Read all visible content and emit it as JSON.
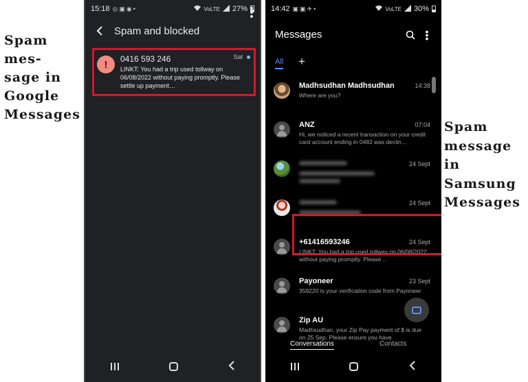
{
  "captions": {
    "google": "Spam mes-\nsage in\nGoogle\nMessages",
    "samsung": "Spam\nmessage\nin\nSamsung\nMessages"
  },
  "google": {
    "status": {
      "time": "15:18",
      "battery": "27%",
      "signal": "VoLTE"
    },
    "title": "Spam and blocked",
    "message": {
      "sender": "0416 593 246",
      "date": "Sat",
      "body": "LINKT: You had a trip used tollway on 06/08/2022 without paying promptly.  Please settle up payment…"
    }
  },
  "samsung": {
    "status": {
      "time": "14:42",
      "battery": "30%",
      "signal": "VoLTE"
    },
    "title": "Messages",
    "tabs": {
      "all": "All",
      "add": "+"
    },
    "conversations": [
      {
        "name": "Madhsudhan Madhsudhan",
        "date": "14:38",
        "preview": "Where are you?"
      },
      {
        "name": "ANZ",
        "date": "07:04",
        "preview": "Hi, we noticed a recent transaction on your credit card account ending in 0482 was declin…"
      },
      {
        "name": "",
        "date": "24 Sept",
        "preview": ""
      },
      {
        "name": "",
        "date": "24 Sept",
        "preview": ""
      },
      {
        "name": "+61416593246",
        "date": "24 Sept",
        "preview": "LINKT: You had a trip used tollway on 06/08/2022 without paying promptly.  Please…"
      },
      {
        "name": "Payoneer",
        "date": "23 Sept",
        "preview": "359220 is your verification code from Payoneer"
      },
      {
        "name": "Zip AU",
        "date": "",
        "preview": "Madhsudhan, your Zip Pay payment of $ is due on 25 Sep. Please ensure you have"
      }
    ],
    "bottom_tabs": {
      "conversations": "Conversations",
      "contacts": "Contacts"
    }
  },
  "colors": {
    "highlight": "#d2192c",
    "samsung_accent": "#5b8eff",
    "spam_alert": "#f28b82"
  }
}
